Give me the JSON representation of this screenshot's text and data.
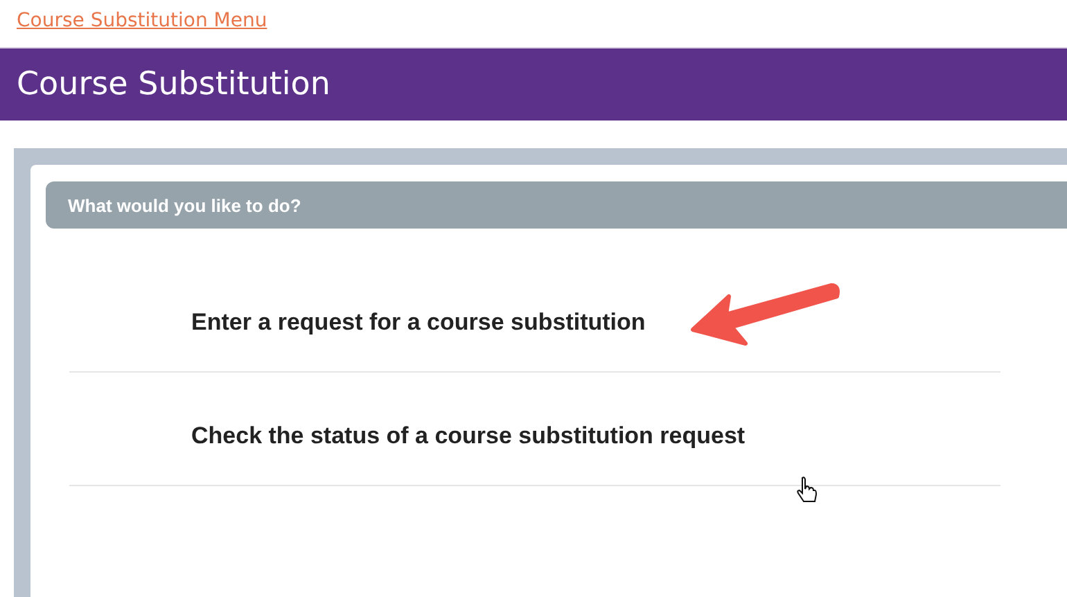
{
  "breadcrumb": "Course Substitution Menu",
  "title": "Course Substitution",
  "panel": {
    "heading": "What would you like to do?",
    "options": [
      {
        "label": "Enter a request for a course substitution"
      },
      {
        "label": "Check the status of a course substitution request"
      }
    ]
  }
}
